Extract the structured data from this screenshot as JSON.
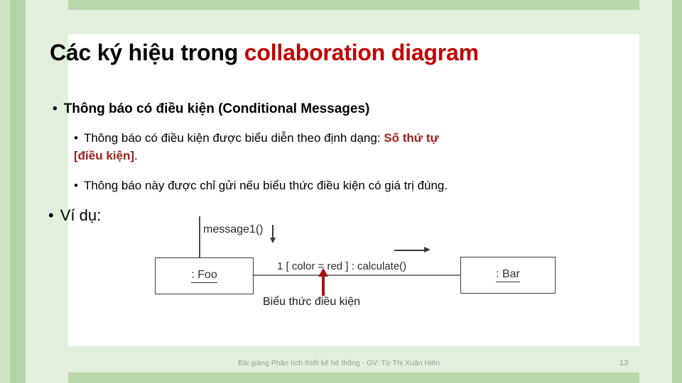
{
  "slide": {
    "title_plain": "Các ký hiệu trong ",
    "title_accent": "collaboration diagram",
    "bullets": {
      "level1_first": "Thông báo có điều kiện (Conditional Messages)",
      "level2_first_a": "Thông báo có điều kiện được biểu diễn theo định dạng:",
      "level2_first_red1": "Số thứ tự",
      "level2_first_red2": "[điều kiện]",
      "level2_first_end": ".",
      "level2_second": "Thông báo này được chỉ gửi nếu biểu thức điều kiện có giá trị đúng.",
      "level1_second": "Ví dụ:",
      "marker": "•"
    },
    "diagram": {
      "node_foo": ": Foo",
      "node_bar": ": Bar",
      "message_label": "message1()",
      "condition_message": "1 [ color = red ] :  calculate()",
      "annotation": "Biểu thức điều kiện"
    },
    "footer": {
      "text": "Bài giảng Phân tích thiết kế hệ thống - GV: Từ Thị Xuân Hiền",
      "page": "13"
    },
    "colors": {
      "accent_red": "#c00000",
      "emphasis_red": "#a02020",
      "arrow_red": "#a31515",
      "frame_green_dark": "#b4d3a6",
      "frame_green_light": "#e2efdc"
    }
  }
}
